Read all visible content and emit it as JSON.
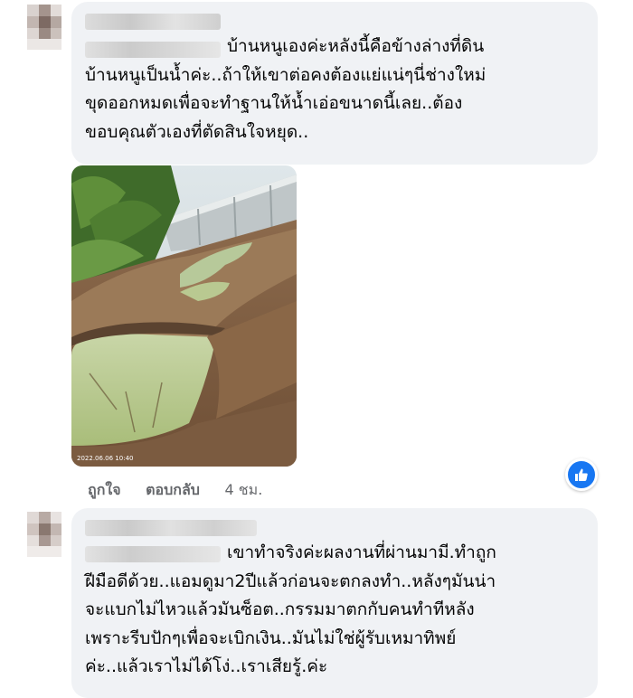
{
  "comments": [
    {
      "text": "บ้านหนูเองค่ะหลังนี้คือข้างล่างที่ดิน\nบ้านหนูเป็นน้ำค่ะ..ถ้าให้เขาต่อคงต้องแย่แน่ๆนี่ช่างใหม่\nขุดออกหมดเพื่อจะทำฐานให้น้ำเอ่อขนาดนี้เลย..ต้อง\nขอบคุณตัวเองที่ตัดสินใจหยุด..",
      "photo_stamp": "2022.06.06 10:40",
      "actions": {
        "like": "ถูกใจ",
        "reply": "ตอบกลับ",
        "time": "4 ชม."
      },
      "reaction_icon": "thumbs-up-icon"
    },
    {
      "text": "เขาทำจริงค่ะผลงานที่ผ่านมามี.ทำถูก\nฝีมือดีด้วย..แอมดูมา2ปีแล้วก่อนจะตกลงทำ..หลังๆมันน่า\nจะแบกไม่ไหวแล้วมันซ็อต..กรรมมาตกกับคนทำทีหลัง\nเพราะรีบปักๆเพื่อจะเบิกเงิน..มันไม่ใช่ผู้รับเหมาทิพย์\nค่ะ..แล้วเราไม่ได้โง่..เราเสียรู้.ค่ะ"
    }
  ],
  "colors": {
    "bubble": "#f0f2f5",
    "meta": "#65676b",
    "accent": "#1877f2"
  }
}
